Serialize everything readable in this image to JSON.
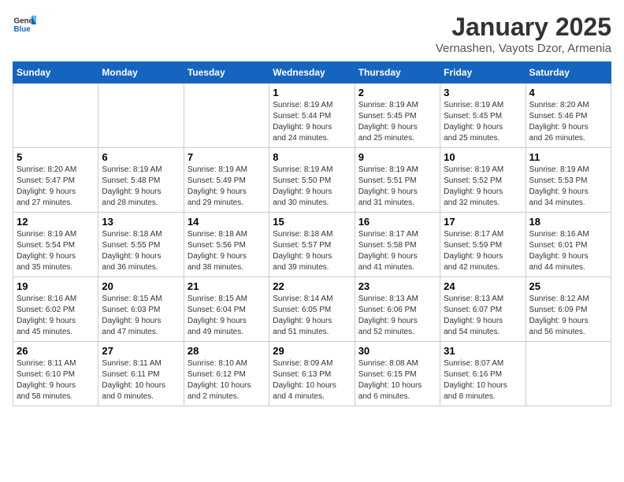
{
  "header": {
    "logo_general": "General",
    "logo_blue": "Blue",
    "month_title": "January 2025",
    "location": "Vernashen, Vayots Dzor, Armenia"
  },
  "weekdays": [
    "Sunday",
    "Monday",
    "Tuesday",
    "Wednesday",
    "Thursday",
    "Friday",
    "Saturday"
  ],
  "weeks": [
    [
      {
        "day": "",
        "info": ""
      },
      {
        "day": "",
        "info": ""
      },
      {
        "day": "",
        "info": ""
      },
      {
        "day": "1",
        "info": "Sunrise: 8:19 AM\nSunset: 5:44 PM\nDaylight: 9 hours\nand 24 minutes."
      },
      {
        "day": "2",
        "info": "Sunrise: 8:19 AM\nSunset: 5:45 PM\nDaylight: 9 hours\nand 25 minutes."
      },
      {
        "day": "3",
        "info": "Sunrise: 8:19 AM\nSunset: 5:45 PM\nDaylight: 9 hours\nand 25 minutes."
      },
      {
        "day": "4",
        "info": "Sunrise: 8:20 AM\nSunset: 5:46 PM\nDaylight: 9 hours\nand 26 minutes."
      }
    ],
    [
      {
        "day": "5",
        "info": "Sunrise: 8:20 AM\nSunset: 5:47 PM\nDaylight: 9 hours\nand 27 minutes."
      },
      {
        "day": "6",
        "info": "Sunrise: 8:19 AM\nSunset: 5:48 PM\nDaylight: 9 hours\nand 28 minutes."
      },
      {
        "day": "7",
        "info": "Sunrise: 8:19 AM\nSunset: 5:49 PM\nDaylight: 9 hours\nand 29 minutes."
      },
      {
        "day": "8",
        "info": "Sunrise: 8:19 AM\nSunset: 5:50 PM\nDaylight: 9 hours\nand 30 minutes."
      },
      {
        "day": "9",
        "info": "Sunrise: 8:19 AM\nSunset: 5:51 PM\nDaylight: 9 hours\nand 31 minutes."
      },
      {
        "day": "10",
        "info": "Sunrise: 8:19 AM\nSunset: 5:52 PM\nDaylight: 9 hours\nand 32 minutes."
      },
      {
        "day": "11",
        "info": "Sunrise: 8:19 AM\nSunset: 5:53 PM\nDaylight: 9 hours\nand 34 minutes."
      }
    ],
    [
      {
        "day": "12",
        "info": "Sunrise: 8:19 AM\nSunset: 5:54 PM\nDaylight: 9 hours\nand 35 minutes."
      },
      {
        "day": "13",
        "info": "Sunrise: 8:18 AM\nSunset: 5:55 PM\nDaylight: 9 hours\nand 36 minutes."
      },
      {
        "day": "14",
        "info": "Sunrise: 8:18 AM\nSunset: 5:56 PM\nDaylight: 9 hours\nand 38 minutes."
      },
      {
        "day": "15",
        "info": "Sunrise: 8:18 AM\nSunset: 5:57 PM\nDaylight: 9 hours\nand 39 minutes."
      },
      {
        "day": "16",
        "info": "Sunrise: 8:17 AM\nSunset: 5:58 PM\nDaylight: 9 hours\nand 41 minutes."
      },
      {
        "day": "17",
        "info": "Sunrise: 8:17 AM\nSunset: 5:59 PM\nDaylight: 9 hours\nand 42 minutes."
      },
      {
        "day": "18",
        "info": "Sunrise: 8:16 AM\nSunset: 6:01 PM\nDaylight: 9 hours\nand 44 minutes."
      }
    ],
    [
      {
        "day": "19",
        "info": "Sunrise: 8:16 AM\nSunset: 6:02 PM\nDaylight: 9 hours\nand 45 minutes."
      },
      {
        "day": "20",
        "info": "Sunrise: 8:15 AM\nSunset: 6:03 PM\nDaylight: 9 hours\nand 47 minutes."
      },
      {
        "day": "21",
        "info": "Sunrise: 8:15 AM\nSunset: 6:04 PM\nDaylight: 9 hours\nand 49 minutes."
      },
      {
        "day": "22",
        "info": "Sunrise: 8:14 AM\nSunset: 6:05 PM\nDaylight: 9 hours\nand 51 minutes."
      },
      {
        "day": "23",
        "info": "Sunrise: 8:13 AM\nSunset: 6:06 PM\nDaylight: 9 hours\nand 52 minutes."
      },
      {
        "day": "24",
        "info": "Sunrise: 8:13 AM\nSunset: 6:07 PM\nDaylight: 9 hours\nand 54 minutes."
      },
      {
        "day": "25",
        "info": "Sunrise: 8:12 AM\nSunset: 6:09 PM\nDaylight: 9 hours\nand 56 minutes."
      }
    ],
    [
      {
        "day": "26",
        "info": "Sunrise: 8:11 AM\nSunset: 6:10 PM\nDaylight: 9 hours\nand 58 minutes."
      },
      {
        "day": "27",
        "info": "Sunrise: 8:11 AM\nSunset: 6:11 PM\nDaylight: 10 hours\nand 0 minutes."
      },
      {
        "day": "28",
        "info": "Sunrise: 8:10 AM\nSunset: 6:12 PM\nDaylight: 10 hours\nand 2 minutes."
      },
      {
        "day": "29",
        "info": "Sunrise: 8:09 AM\nSunset: 6:13 PM\nDaylight: 10 hours\nand 4 minutes."
      },
      {
        "day": "30",
        "info": "Sunrise: 8:08 AM\nSunset: 6:15 PM\nDaylight: 10 hours\nand 6 minutes."
      },
      {
        "day": "31",
        "info": "Sunrise: 8:07 AM\nSunset: 6:16 PM\nDaylight: 10 hours\nand 8 minutes."
      },
      {
        "day": "",
        "info": ""
      }
    ]
  ]
}
